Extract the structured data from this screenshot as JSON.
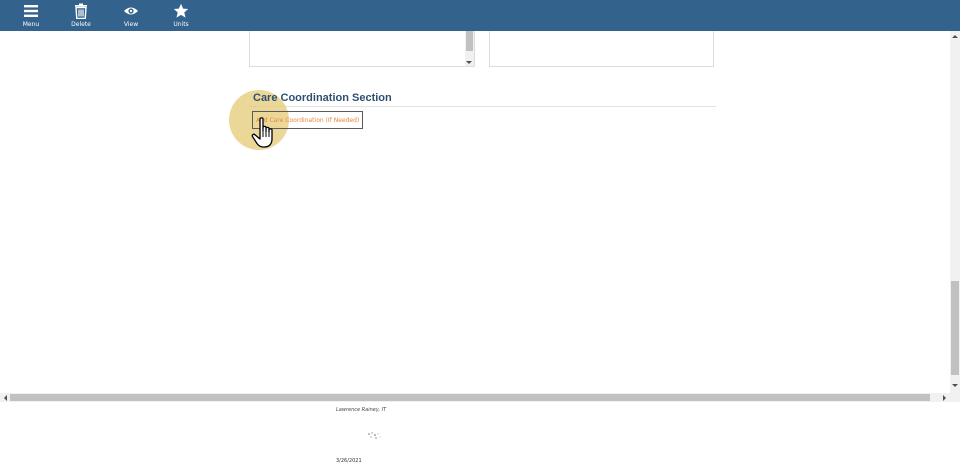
{
  "toolbar": {
    "items": [
      {
        "label": "Menu",
        "icon": "menu-icon"
      },
      {
        "label": "Delete",
        "icon": "trash-icon"
      },
      {
        "label": "View",
        "icon": "eye-icon"
      },
      {
        "label": "Units",
        "icon": "star-icon"
      }
    ],
    "background": "#33628c"
  },
  "care_coordination": {
    "title": "Care Coordination Section",
    "add_button_label": "Add Care Coordination (If Needed)"
  },
  "footer": {
    "author": "Lawrence Rainey, IT",
    "date": "3/26/2021"
  },
  "colors": {
    "title": "#2d4f72",
    "button_text": "#e8863a",
    "highlight": "#e2c86e"
  }
}
